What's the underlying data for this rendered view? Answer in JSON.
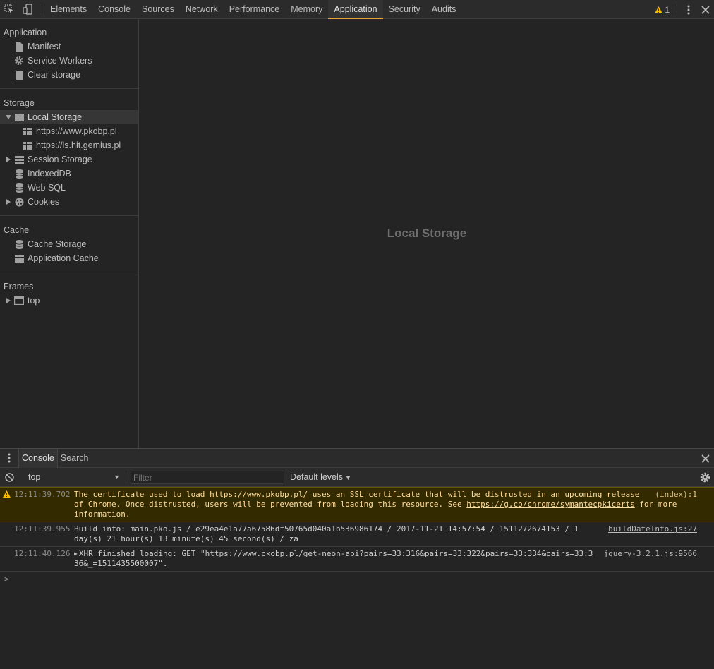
{
  "topbar": {
    "tabs": [
      "Elements",
      "Console",
      "Sources",
      "Network",
      "Performance",
      "Memory",
      "Application",
      "Security",
      "Audits"
    ],
    "active_tab": "Application",
    "warning_count": "1"
  },
  "sidebar": {
    "application_title": "Application",
    "application_items": [
      "Manifest",
      "Service Workers",
      "Clear storage"
    ],
    "storage_title": "Storage",
    "local_storage": "Local Storage",
    "local_storage_children": [
      "https://www.pkobp.pl",
      "https://ls.hit.gemius.pl"
    ],
    "session_storage": "Session Storage",
    "indexeddb": "IndexedDB",
    "websql": "Web SQL",
    "cookies": "Cookies",
    "cache_title": "Cache",
    "cache_storage": "Cache Storage",
    "application_cache": "Application Cache",
    "frames_title": "Frames",
    "frames_top": "top"
  },
  "main": {
    "placeholder": "Local Storage"
  },
  "drawer": {
    "tabs": [
      "Console",
      "Search"
    ],
    "active_tab": "Console",
    "context": "top",
    "filter_placeholder": "Filter",
    "levels": "Default levels",
    "messages": [
      {
        "level": "warning",
        "timestamp": "12:11:39.702",
        "text_1": "The certificate used to load ",
        "link_1": "https://www.pkobp.pl/",
        "text_2": " uses an SSL certificate that will be distrusted in an upcoming release of Chrome. Once distrusted, users will be prevented from loading this resource. See ",
        "link_2": "https://g.co/chrome/symantecpkicerts",
        "text_3": " for more information.",
        "source": "(index):1"
      },
      {
        "level": "info",
        "timestamp": "12:11:39.955",
        "text": "Build info: main.pko.js / e29ea4e1a77a67586df50765d040a1b536986174 / 2017-11-21 14:57:54 / 1511272674153 / 1 day(s) 21 hour(s) 13 minute(s) 45 second(s) / za",
        "source": "buildDateInfo.js:27"
      },
      {
        "level": "info",
        "timestamp": "12:11:40.126",
        "text_1": "XHR finished loading: GET \"",
        "link": "https://www.pkobp.pl/get-neon-api?pairs=33:316&pairs=33:322&pairs=33:334&pairs=33:336&_=1511435500007",
        "text_2": "\".",
        "source": "jquery-3.2.1.js:9566"
      }
    ],
    "prompt": ">"
  }
}
